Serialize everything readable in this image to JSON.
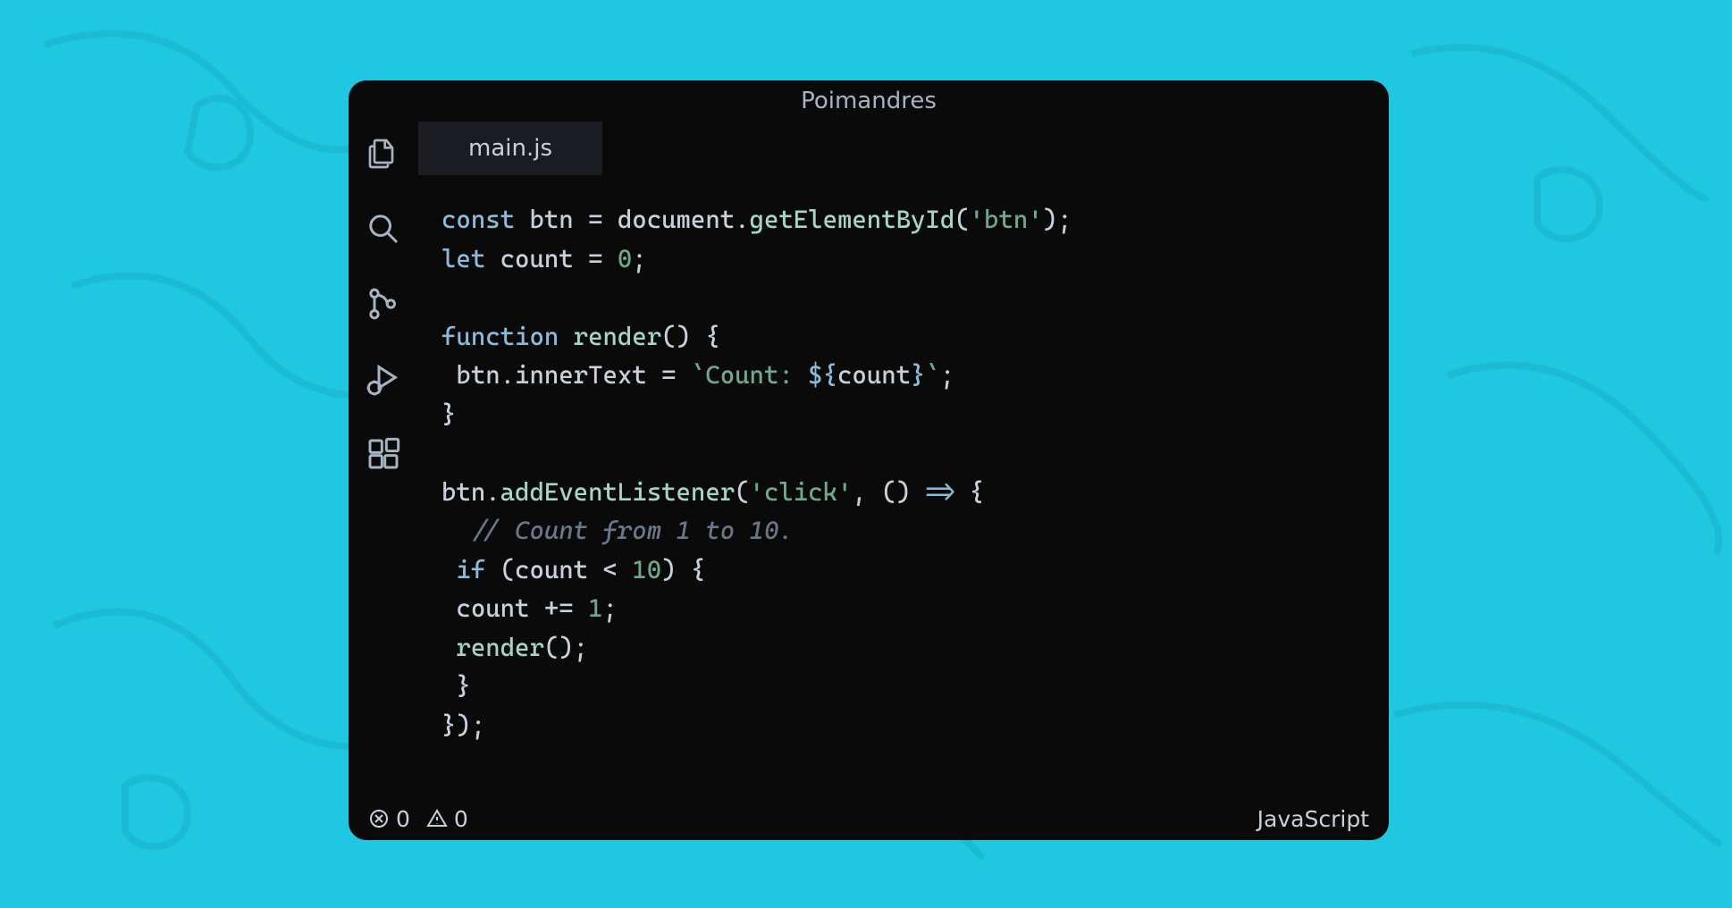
{
  "title": "Poimandres",
  "tab": {
    "label": "main.js"
  },
  "status": {
    "errors": "0",
    "warnings": "0",
    "language": "JavaScript"
  },
  "code": {
    "l1": {
      "kw": "const",
      "sp1": " ",
      "id1": "btn",
      "sp2": " ",
      "eq": "=",
      "sp3": " ",
      "obj": "document",
      "dot": ".",
      "fn": "getElementById",
      "op": "(",
      "str": "'btn'",
      "cl": ")",
      "semi": ";"
    },
    "l2": {
      "kw": "let",
      "sp1": " ",
      "id1": "count",
      "sp2": " ",
      "eq": "=",
      "sp3": " ",
      "num": "0",
      "semi": ";"
    },
    "l3": {
      "blank": ""
    },
    "l4": {
      "kw": "function",
      "sp1": " ",
      "fn": "render",
      "parens": "()",
      "sp2": " ",
      "brace": "{"
    },
    "l5": {
      "indent": " ",
      "id1": "btn",
      "dot": ".",
      "prop": "innerText",
      "sp1": " ",
      "eq": "=",
      "sp2": " ",
      "bt1": "`",
      "tstr1": "Count: ",
      "do": "${",
      "tvar": "count",
      "dc": "}",
      "bt2": "`",
      "semi": ";"
    },
    "l6": {
      "brace": "}"
    },
    "l7": {
      "blank": ""
    },
    "l8": {
      "id1": "btn",
      "dot": ".",
      "fn": "addEventListener",
      "op": "(",
      "str": "'click'",
      "comma": ",",
      "sp1": " ",
      "paren": "()",
      "sp2": " ",
      "arrow": "=>",
      "sp3": " ",
      "brace": "{"
    },
    "l9": {
      "indent": "  ",
      "cmt": "// Count from 1 to 10."
    },
    "l10": {
      "indent": " ",
      "kw": "if",
      "sp1": " ",
      "op": "(",
      "id1": "count",
      "sp2": " ",
      "lt": "<",
      "sp3": " ",
      "num": "10",
      "cl": ")",
      "sp4": " ",
      "brace": "{"
    },
    "l11": {
      "indent": " ",
      "id1": "count",
      "sp1": " ",
      "opeq": "+=",
      "sp2": " ",
      "num": "1",
      "semi": ";"
    },
    "l12": {
      "indent": " ",
      "fn": "render",
      "parens": "()",
      "semi": ";"
    },
    "l13": {
      "indent": " ",
      "brace": "}"
    },
    "l14": {
      "brace": "})",
      "semi": ";"
    }
  }
}
